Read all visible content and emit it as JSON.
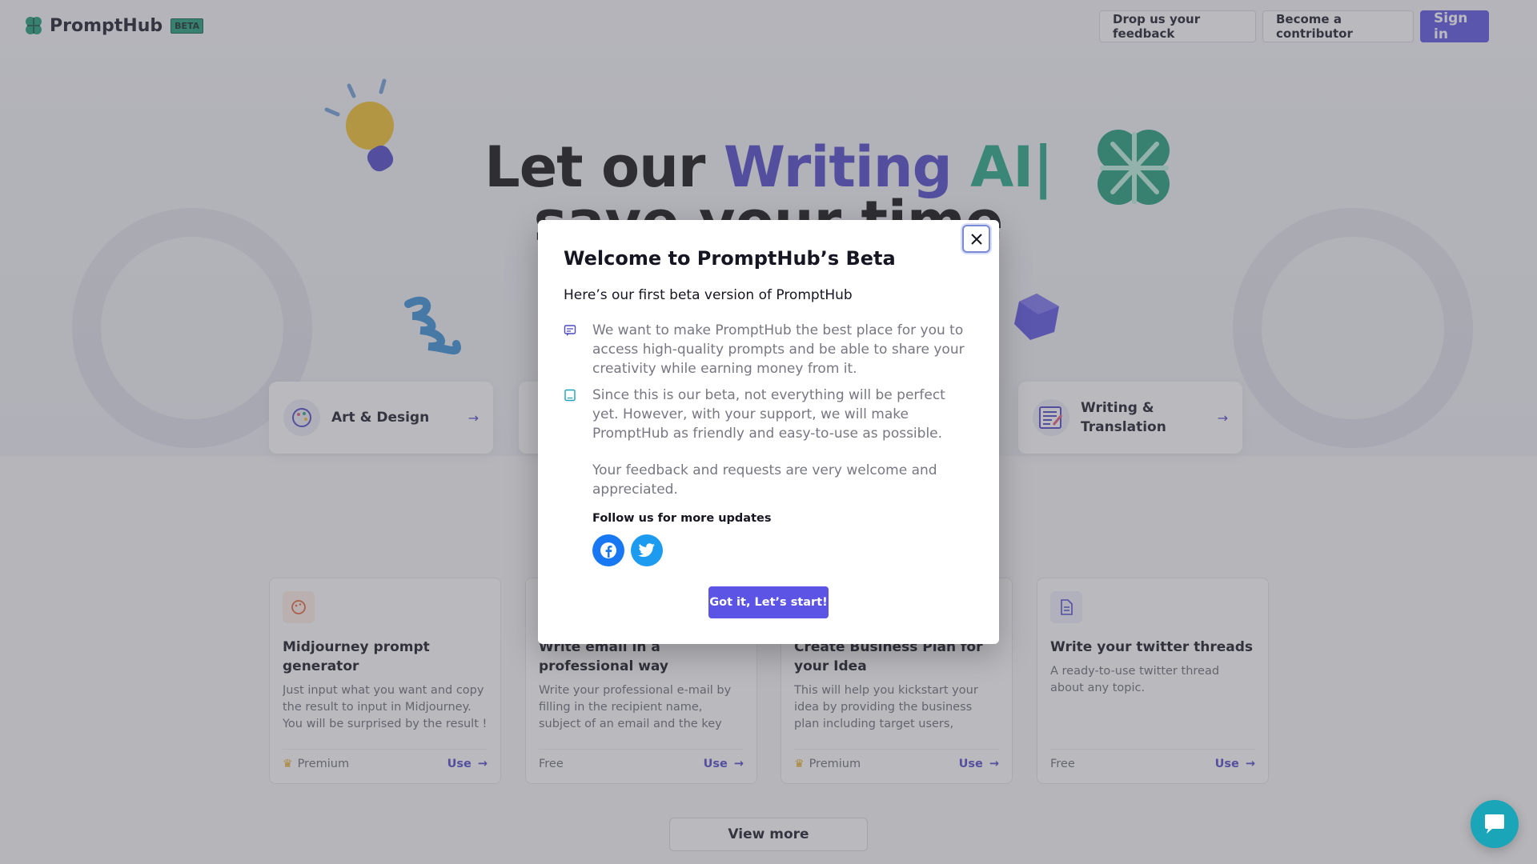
{
  "brand": {
    "name": "PromptHub",
    "badge": "BETA"
  },
  "nav": {
    "feedback": "Drop us your feedback",
    "contributor": "Become a contributor",
    "signin": "Sign in"
  },
  "hero": {
    "line1_a": "Let our ",
    "line1_b": "Writing ",
    "line1_c": "AI|",
    "line2": "save your time"
  },
  "categories": [
    {
      "label": "Art & Design"
    },
    {
      "label": "Writing & Translation"
    }
  ],
  "tools": [
    {
      "title": "Midjourney prompt generator",
      "desc": "Just input what you want and copy the result to input in Midjourney. You will be surprised by the result !",
      "tier": "Premium",
      "use": "Use"
    },
    {
      "title": "Write email in a professional way",
      "desc": "Write your professional e-mail by filling in the recipient name, subject of an email and the key informatio...",
      "tier": "Free",
      "use": "Use"
    },
    {
      "title": "Create Business Plan for your Idea",
      "desc": "This will help you kickstart your idea by providing the business plan including target users, market...",
      "tier": "Premium",
      "use": "Use"
    },
    {
      "title": "Write your twitter threads",
      "desc": "A ready-to-use twitter thread about any topic.",
      "tier": "Free",
      "use": "Use"
    }
  ],
  "view_more": "View more",
  "modal": {
    "title": "Welcome to PromptHub’s Beta",
    "subtitle": "Here’s our first beta version of PromptHub",
    "items": [
      "We want to make PromptHub the best place for you to access high-quality prompts and be able to share your creativity while earning money from it.",
      "Since this is our beta, not everything will be perfect yet. However, with your support, we will make PromptHub as friendly and easy-to-use as possible."
    ],
    "note": "Your feedback and requests are very welcome and appreciated.",
    "follow": "Follow us for more updates",
    "cta": "Got it, Let’s start!"
  },
  "colors": {
    "accent": "#5b54e4",
    "brand_green": "#23a585",
    "facebook": "#1877f2",
    "twitter": "#1d9bf0",
    "chat": "#1aa5b8"
  }
}
